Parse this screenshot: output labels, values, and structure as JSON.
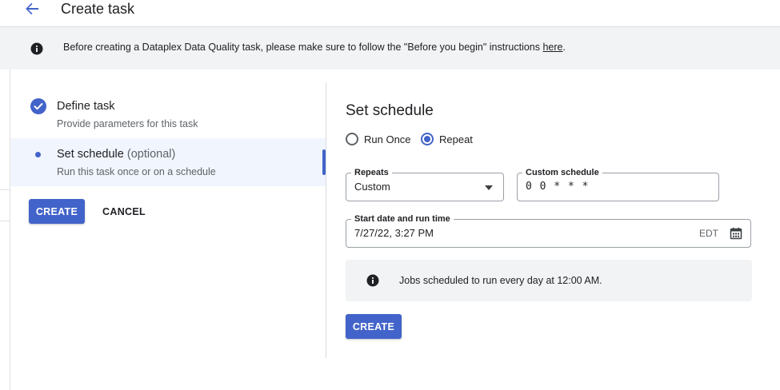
{
  "header": {
    "title": "Create task"
  },
  "banner": {
    "text": "Before creating a Dataplex Data Quality task, please make sure to follow the \"Before you begin\" instructions ",
    "link": "here",
    "suffix": "."
  },
  "steps": [
    {
      "title": "Define task",
      "subtitle": "Provide parameters for this task",
      "status": "completed"
    },
    {
      "title": "Set schedule",
      "optional": "(optional)",
      "subtitle": "Run this task once or on a schedule",
      "status": "active"
    }
  ],
  "left_actions": {
    "create": "CREATE",
    "cancel": "CANCEL"
  },
  "schedule": {
    "title": "Set schedule",
    "radio": {
      "once": "Run Once",
      "repeat": "Repeat",
      "selected": "Repeat"
    },
    "repeats": {
      "label": "Repeats",
      "value": "Custom"
    },
    "custom": {
      "label": "Custom schedule",
      "value": "0 0 * * *"
    },
    "start": {
      "label": "Start date and run time",
      "value": "7/27/22, 3:27 PM",
      "tz": "EDT"
    },
    "notice": "Jobs scheduled to run every day at 12:00 AM.",
    "create": "CREATE"
  },
  "colors": {
    "accent": "#4263c9",
    "banner_bg": "#f1f3f4",
    "active_step_bg": "#f1f5fd"
  },
  "icons": [
    "arrow-back-icon",
    "info-icon",
    "check-circle-icon",
    "calendar-icon",
    "dropdown-arrow-icon"
  ]
}
